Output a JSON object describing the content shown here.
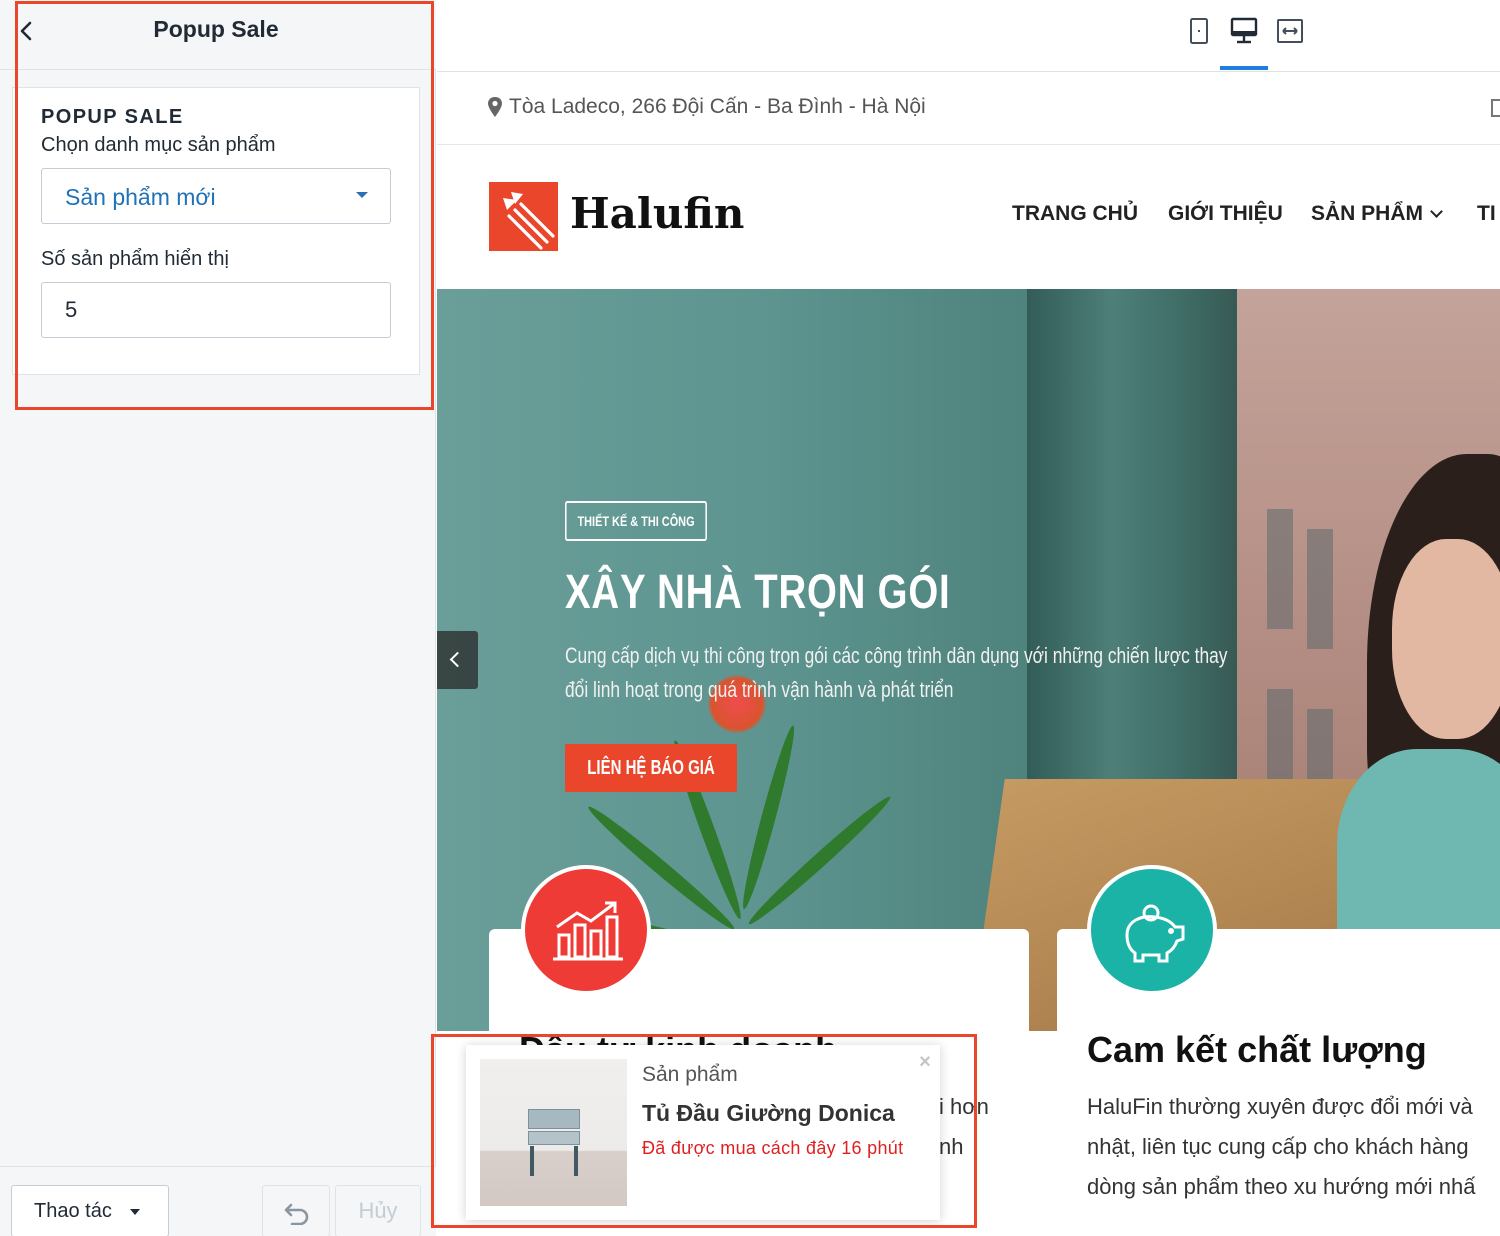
{
  "editor": {
    "title": "Popup Sale",
    "section_heading": "POPUP SALE",
    "category_label": "Chọn danh mục sản phẩm",
    "category_value": "Sản phẩm mới",
    "count_label": "Số sản phẩm hiển thị",
    "count_value": "5",
    "footer": {
      "actions_label": "Thao tác",
      "cancel_label": "Hủy"
    }
  },
  "devices": [
    "mobile-icon",
    "desktop-icon",
    "fullwidth-icon"
  ],
  "site": {
    "address": "Tòa Ladeco, 266 Đội Cấn - Ba Đình - Hà Nội",
    "logo_text": "Halufin",
    "nav": [
      {
        "label": "TRANG CHỦ"
      },
      {
        "label": "GIỚI THIỆU"
      },
      {
        "label": "SẢN PHẨM"
      },
      {
        "label": "TI"
      }
    ],
    "hero": {
      "tag": "THIẾT KẾ & THI CÔNG",
      "title": "XÂY NHÀ TRỌN GÓI",
      "description": "Cung cấp dịch vụ thi công trọn gói các công trình dân dụng với những chiến lược thay đổi linh hoạt trong quá trình vận hành và phát triển",
      "cta": "LIÊN HỆ BÁO GIÁ"
    },
    "features": [
      {
        "title": "Đầu tư kinh doanh",
        "lines": [
          "i hơn",
          "nh"
        ],
        "icon": "chart-growth-icon",
        "color": "#ee3b36"
      },
      {
        "title": "Cam kết chất lượng",
        "lines": [
          "HaluFin thường xuyên được đổi mới và",
          "nhật, liên tục cung cấp cho khách hàng",
          "dòng sản phẩm theo xu hướng mới nhấ"
        ],
        "icon": "piggy-bank-icon",
        "color": "#1bb3a5"
      }
    ]
  },
  "popup": {
    "category": "Sản phẩm",
    "product": "Tủ Đầu Giường Donica",
    "time": "Đã được mua cách đây 16 phút"
  },
  "colors": {
    "accent": "#e9462c",
    "link_blue": "#1f72b8",
    "active_device": "#1f7fe0",
    "popup_time": "#e02020"
  }
}
